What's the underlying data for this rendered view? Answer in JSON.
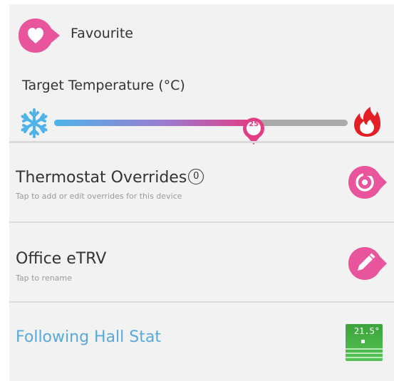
{
  "favourite": {
    "label": "Favourite",
    "icon": "heart-icon",
    "color": "#e8559c"
  },
  "target": {
    "label": "Target Temperature (°C)",
    "value": "25",
    "level_percent": 68,
    "cold_icon": "snowflake-icon",
    "hot_icon": "flame-icon",
    "cold_color": "#4fb3ea",
    "hot_color": "#e31e24"
  },
  "rows": [
    {
      "title": "Thermostat Overrides",
      "badge": "0",
      "subtitle": "Tap to add or edit overrides for this device",
      "icon": "override-icon"
    },
    {
      "title": "Office eTRV",
      "subtitle": "Tap to rename",
      "icon": "pencil-icon"
    }
  ],
  "follow": {
    "text": "Following Hall Stat",
    "stat_temp": "21.5°",
    "icon": "hall-stat-icon",
    "color": "#5aa9d8"
  },
  "accent": "#e8559c"
}
